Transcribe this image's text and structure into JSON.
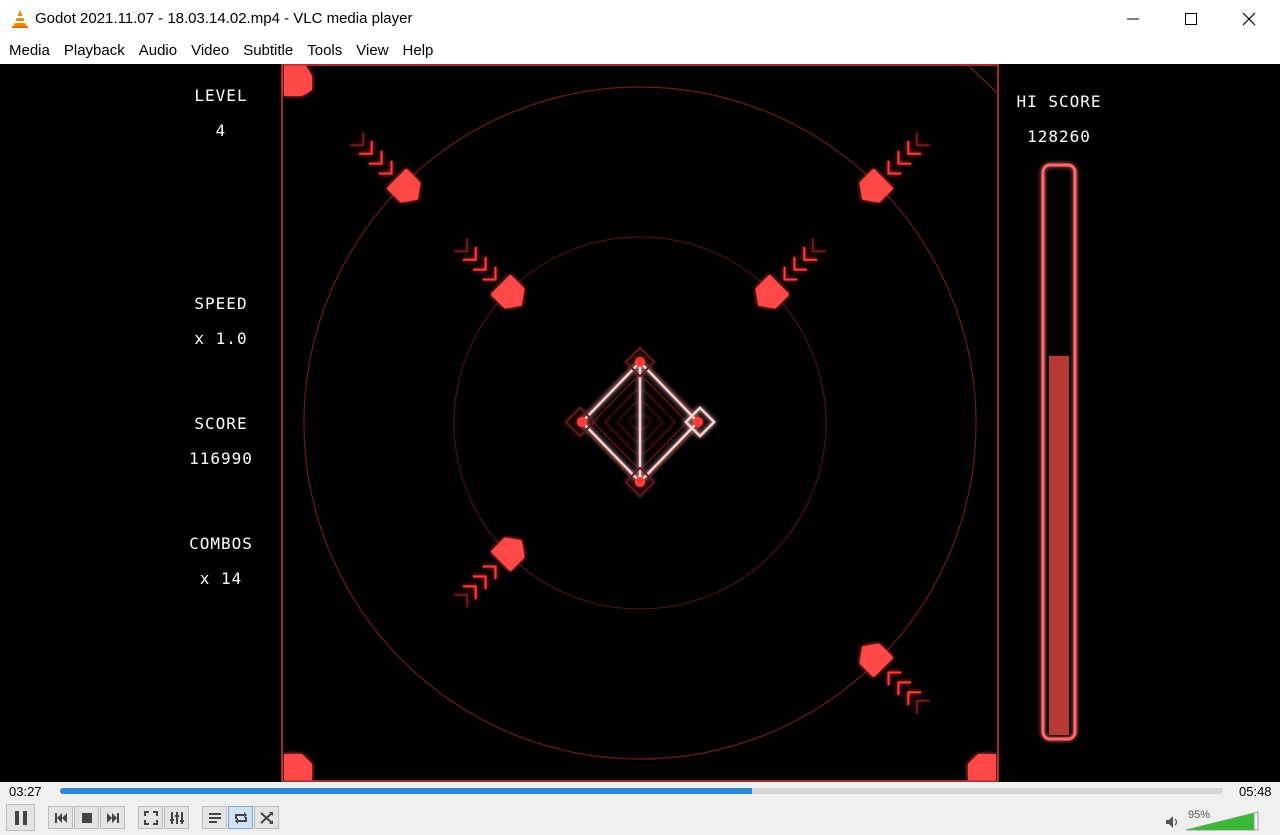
{
  "window": {
    "title": "Godot 2021.11.07 - 18.03.14.02.mp4 - VLC media player",
    "app_icon": "vlc-cone-icon",
    "controls": [
      "minimize-icon",
      "maximize-icon",
      "close-icon"
    ]
  },
  "menu": {
    "items": [
      "Media",
      "Playback",
      "Audio",
      "Video",
      "Subtitle",
      "Tools",
      "View",
      "Help"
    ]
  },
  "game_hud": {
    "level_label": "LEVEL",
    "level_value": "4",
    "speed_label": "SPEED",
    "speed_value": "x 1.0",
    "score_label": "SCORE",
    "score_value": "116990",
    "combos_label": "COMBOS",
    "combos_value": "x 14",
    "hiscore_label": "HI SCORE",
    "hiscore_value": "128260",
    "power_meter_fraction": 0.67,
    "accent_color": "#ff3b3b"
  },
  "playback": {
    "elapsed": "03:27",
    "total": "05:48",
    "progress_fraction": 0.595,
    "volume": "95%",
    "volume_fraction": 0.95
  },
  "buttons": {
    "pause": "pause-icon",
    "previous": "previous-icon",
    "stop": "stop-icon",
    "next": "next-icon",
    "fullscreen": "fullscreen-icon",
    "extended": "extended-settings-icon",
    "playlist": "playlist-icon",
    "loop": "loop-icon",
    "shuffle": "shuffle-icon"
  }
}
